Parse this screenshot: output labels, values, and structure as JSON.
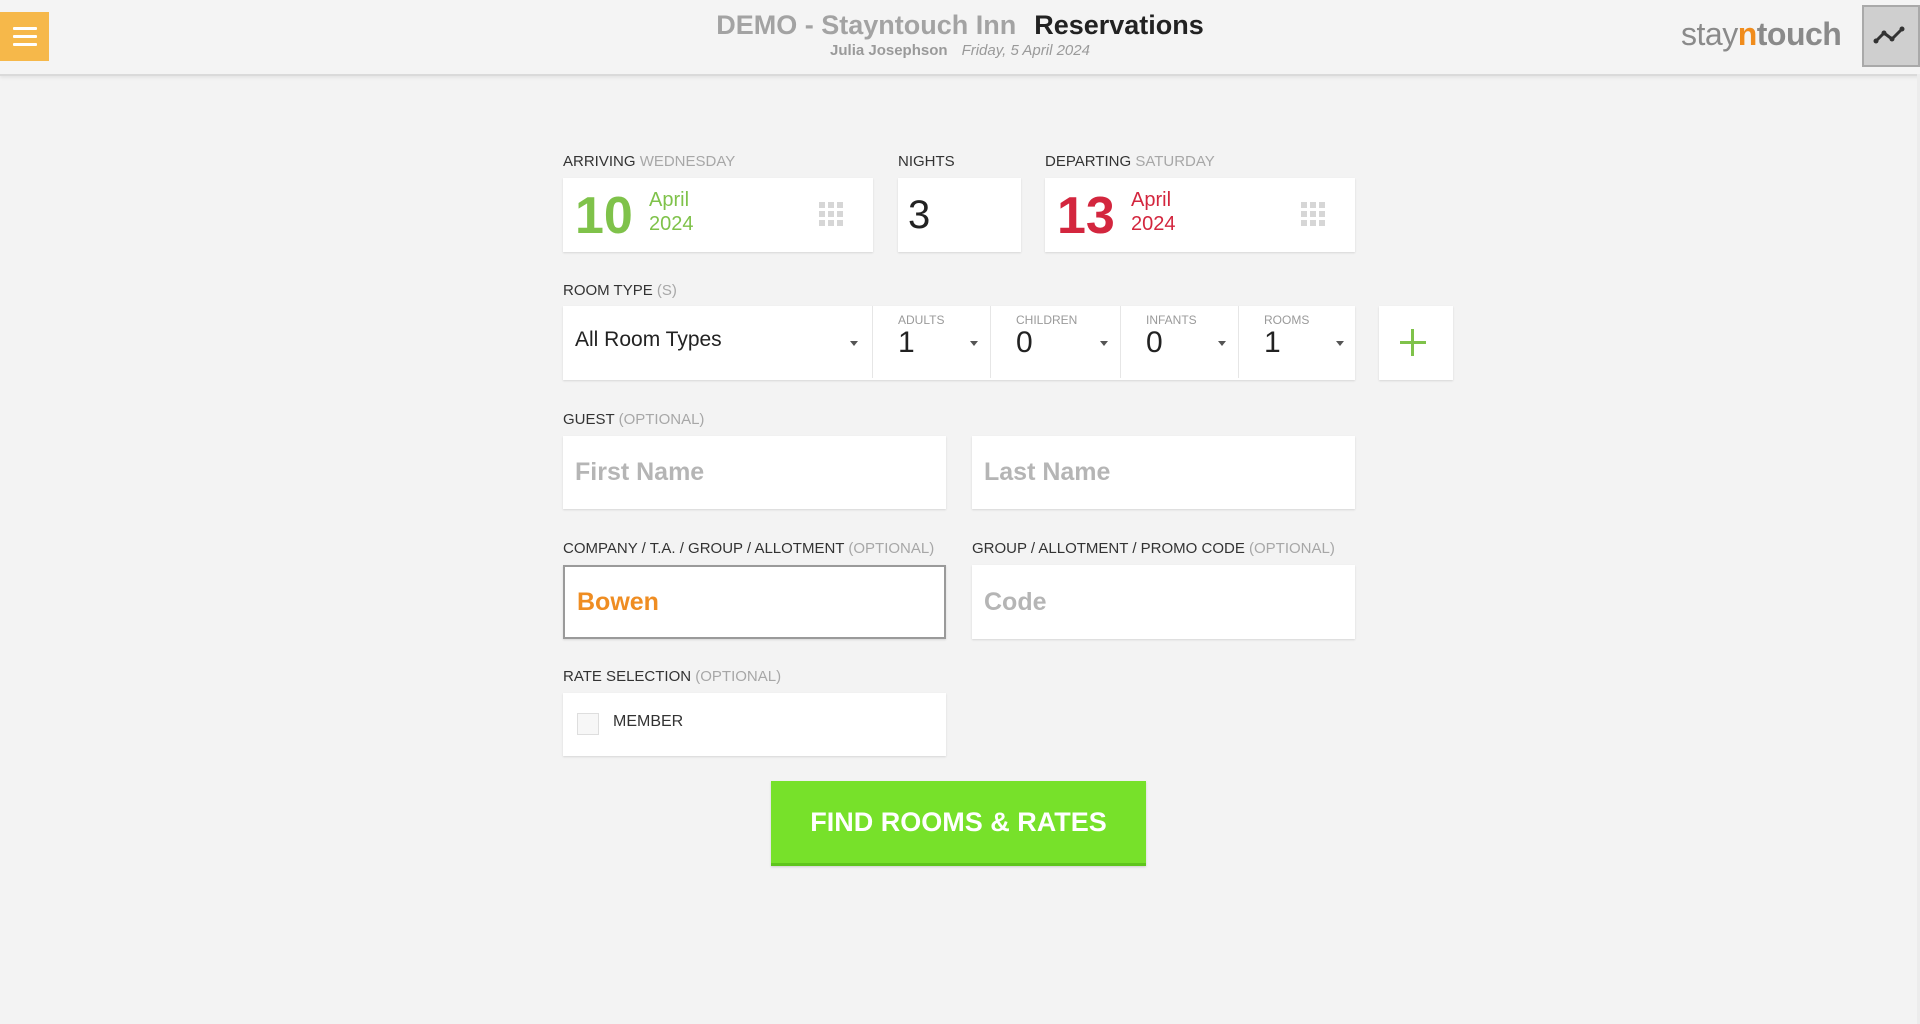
{
  "header": {
    "hotel_name": "DEMO - Stayntouch Inn",
    "page_title": "Reservations",
    "user_name": "Julia Josephson",
    "business_date": "Friday, 5 April 2024",
    "logo": {
      "part1": "stay",
      "part2": "n",
      "part3": "touch"
    },
    "menu_icon": "hamburger-icon",
    "analytics_icon": "line-chart-icon",
    "accent_color": "#f6b84a"
  },
  "arrival": {
    "label": "ARRIVING",
    "weekday": "WEDNESDAY",
    "day": "10",
    "month": "April",
    "year": "2024",
    "color": "#7fc24a"
  },
  "nights": {
    "label": "NIGHTS",
    "value": "3"
  },
  "departure": {
    "label": "DEPARTING",
    "weekday": "SATURDAY",
    "day": "13",
    "month": "April",
    "year": "2024",
    "color": "#d3263e"
  },
  "room": {
    "label": "ROOM TYPE",
    "suffix": "(S)",
    "selected": "All Room Types",
    "adults_label": "ADULTS",
    "adults": "1",
    "children_label": "CHILDREN",
    "children": "0",
    "infants_label": "INFANTS",
    "infants": "0",
    "rooms_label": "ROOMS",
    "rooms": "1"
  },
  "guest": {
    "label": "GUEST",
    "optional": "(OPTIONAL)",
    "first_name_placeholder": "First Name",
    "last_name_placeholder": "Last Name"
  },
  "company": {
    "label": "COMPANY / T.A. / GROUP / ALLOTMENT",
    "optional": "(OPTIONAL)",
    "value": "Bowen"
  },
  "promo": {
    "label": "GROUP / ALLOTMENT / PROMO CODE",
    "optional": "(OPTIONAL)",
    "placeholder": "Code"
  },
  "rate": {
    "label": "RATE SELECTION",
    "optional": "(OPTIONAL)",
    "member_label": "MEMBER",
    "member_checked": false
  },
  "find_button_label": "FIND ROOMS & RATES"
}
